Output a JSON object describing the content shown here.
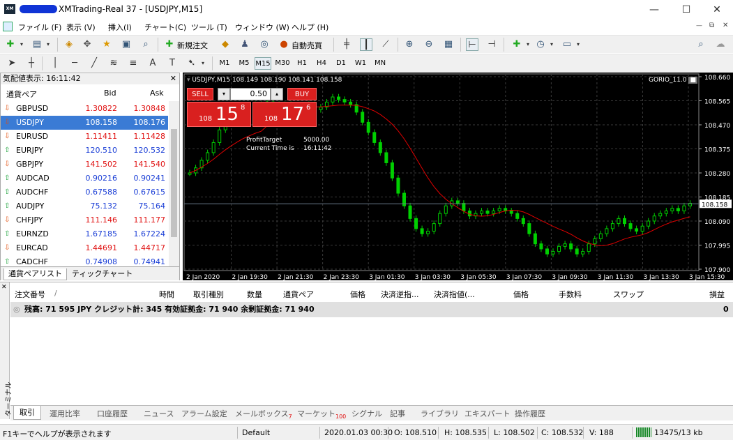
{
  "window": {
    "title": "XMTrading-Real 37 - [USDJPY,M15]",
    "logo": "XM",
    "minimize": "—",
    "maximize": "☐",
    "close": "✕"
  },
  "menu": [
    "ファイル (F)",
    "表示 (V)",
    "挿入(I)",
    "チャート(C)",
    "ツール (T)",
    "ウィンドウ (W)",
    "ヘルプ (H)"
  ],
  "toolbar": {
    "new_order": "新規注文",
    "auto_trade": "自動売買",
    "timeframes": [
      "M1",
      "M5",
      "M15",
      "M30",
      "H1",
      "H4",
      "D1",
      "W1",
      "MN"
    ],
    "active_tf": "M15"
  },
  "market_watch": {
    "header": "気配値表示: 16:11:42",
    "cols": {
      "symbol": "通貨ペア",
      "bid": "Bid",
      "ask": "Ask"
    },
    "rows": [
      {
        "sym": "GBPUSD",
        "bid": "1.30822",
        "ask": "1.30848",
        "dir": "d"
      },
      {
        "sym": "USDJPY",
        "bid": "108.158",
        "ask": "108.176",
        "dir": "d",
        "selected": true
      },
      {
        "sym": "EURUSD",
        "bid": "1.11411",
        "ask": "1.11428",
        "dir": "d"
      },
      {
        "sym": "EURJPY",
        "bid": "120.510",
        "ask": "120.532",
        "dir": "u"
      },
      {
        "sym": "GBPJPY",
        "bid": "141.502",
        "ask": "141.540",
        "dir": "d"
      },
      {
        "sym": "AUDCAD",
        "bid": "0.90216",
        "ask": "0.90241",
        "dir": "u"
      },
      {
        "sym": "AUDCHF",
        "bid": "0.67588",
        "ask": "0.67615",
        "dir": "u"
      },
      {
        "sym": "AUDJPY",
        "bid": "75.132",
        "ask": "75.164",
        "dir": "u"
      },
      {
        "sym": "CHFJPY",
        "bid": "111.146",
        "ask": "111.177",
        "dir": "d"
      },
      {
        "sym": "EURNZD",
        "bid": "1.67185",
        "ask": "1.67224",
        "dir": "u"
      },
      {
        "sym": "EURCAD",
        "bid": "1.44691",
        "ask": "1.44717",
        "dir": "d"
      },
      {
        "sym": "CADCHF",
        "bid": "0.74908",
        "ask": "0.74941",
        "dir": "u"
      }
    ],
    "tabs": [
      "通貨ペアリスト",
      "ティックチャート"
    ]
  },
  "chart": {
    "info": "USDJPY,M15  108.149 108.190 108.141 108.158",
    "indicator": "GORIO_11.0",
    "sell": "SELL",
    "buy": "BUY",
    "lot": "0.50",
    "sell_big": "108",
    "sell_pips": "15",
    "sell_sup": "8",
    "buy_big": "108",
    "buy_pips": "17",
    "buy_sup": "6",
    "profit_label": "ProfitTarget",
    "profit_value": "5000.00",
    "time_label": "Current Time is",
    "time_value": "16:11:42",
    "current_price": "108.158",
    "y_labels": [
      "108.660",
      "108.565",
      "108.470",
      "108.375",
      "108.280",
      "108.185",
      "108.090",
      "107.995",
      "107.900"
    ],
    "x_labels": [
      "2 Jan 2020",
      "2 Jan 19:30",
      "2 Jan 21:30",
      "2 Jan 23:30",
      "3 Jan 01:30",
      "3 Jan 03:30",
      "3 Jan 05:30",
      "3 Jan 07:30",
      "3 Jan 09:30",
      "3 Jan 11:30",
      "3 Jan 13:30",
      "3 Jan 15:30"
    ],
    "colors": {
      "bull": "#00d000",
      "bear": "#00d000",
      "ma": "#e00000",
      "grid": "#3a3a3a"
    }
  },
  "terminal": {
    "side_label": "ターミナル",
    "cols": [
      "注文番号",
      "/",
      "時間",
      "取引種別",
      "数量",
      "通貨ペア",
      "価格",
      "決済逆指...",
      "決済指値(...",
      "価格",
      "手数料",
      "スワップ",
      "損益"
    ],
    "balance": "残高: 71 595 JPY  クレジット計: 345  有効証拠金: 71 940  余剰証拠金: 71 940",
    "pnl": "0",
    "tabs": [
      "取引",
      "運用比率",
      "口座履歴",
      "ニュース",
      "アラーム設定",
      "メールボックス",
      "マーケット",
      "シグナル",
      "記事",
      "ライブラリ",
      "エキスパート",
      "操作履歴"
    ],
    "mail_badge": "7",
    "market_badge": "100"
  },
  "status": {
    "help": "F1キーでヘルプが表示されます",
    "profile": "Default",
    "datetime": "2020.01.03 00:30",
    "open": "O: 108.510",
    "high": "H: 108.535",
    "low": "L: 108.502",
    "close": "C: 108.532",
    "volume": "V: 188",
    "traffic": "13475/13 kb"
  }
}
